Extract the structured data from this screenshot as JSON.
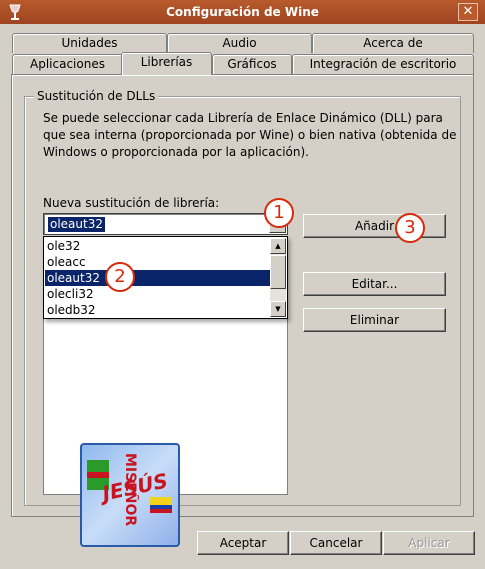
{
  "window": {
    "title": "Configuración de Wine",
    "close_glyph": "✕"
  },
  "tabs_row1": [
    "Unidades",
    "Audio",
    "Acerca de"
  ],
  "tabs_row2": [
    "Aplicaciones",
    "Librerías",
    "Gráficos",
    "Integración de escritorio"
  ],
  "active_tab": "Librerías",
  "group": {
    "legend": "Sustitución de DLLs",
    "description": "Se puede seleccionar cada Librería de Enlace Dinámico (DLL) para que sea interna (proporcionada por Wine) o bien nativa (obtenida de Windows o proporcionada por la aplicación).",
    "combo_label": "Nueva sustitución de librería:",
    "combo_value": "oleaut32",
    "dropdown_items": [
      "ole32",
      "oleacc",
      "oleaut32",
      "olecli32",
      "oledb32"
    ],
    "selected_index": 2
  },
  "buttons": {
    "add": "Añadir",
    "edit": "Editar...",
    "remove": "Eliminar"
  },
  "footer": {
    "accept": "Aceptar",
    "cancel": "Cancelar",
    "apply": "Aplicar"
  },
  "callouts": [
    "1",
    "2",
    "3"
  ],
  "logo": {
    "word1": "JESÚS",
    "word2": "MISEÑOR"
  },
  "icons": {
    "app_icon": "wine-icon",
    "close": "close-icon",
    "scroll_up": "arrow-up-icon",
    "scroll_down": "arrow-down-icon",
    "combo": "chevron-down-icon"
  }
}
